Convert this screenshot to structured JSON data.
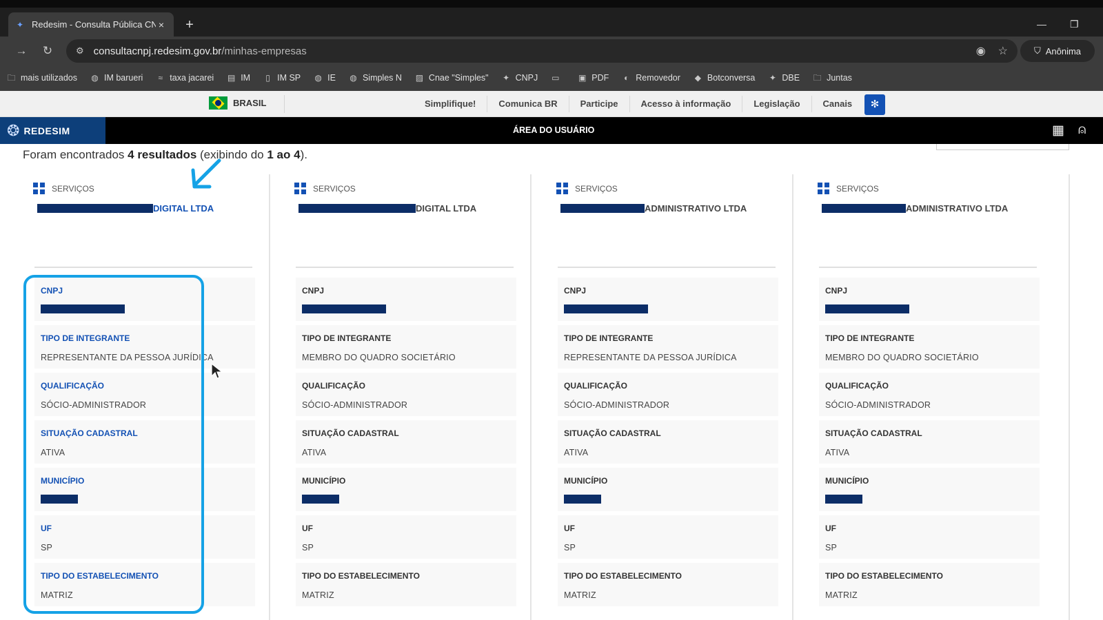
{
  "browser": {
    "tab_title": "Redesim - Consulta Pública CNI",
    "tab_close": "×",
    "new_tab": "+",
    "url_host": "consultacnpj.redesim.gov.br",
    "url_path": "/minhas-empresas",
    "incognito_label": "Anônima",
    "bookmarks": [
      {
        "label": "mais utilizados",
        "icon": "folder-icon"
      },
      {
        "label": "IM barueri",
        "icon": "globe-icon"
      },
      {
        "label": "taxa jacarei",
        "icon": "wave-icon"
      },
      {
        "label": "IM",
        "icon": "eiss-icon"
      },
      {
        "label": "IM SP",
        "icon": "doc-icon"
      },
      {
        "label": "IE",
        "icon": "globe-icon"
      },
      {
        "label": "Simples N",
        "icon": "globe-icon"
      },
      {
        "label": "Cnae \"Simples\"",
        "icon": "stripes-icon"
      },
      {
        "label": "CNPJ",
        "icon": "redesim-icon"
      },
      {
        "label": "",
        "icon": "card-icon"
      },
      {
        "label": "PDF",
        "icon": "pdf-icon"
      },
      {
        "label": "Removedor",
        "icon": "remover-icon"
      },
      {
        "label": "Botconversa",
        "icon": "bot-icon"
      },
      {
        "label": "DBE",
        "icon": "redesim-icon"
      },
      {
        "label": "Juntas",
        "icon": "folder-icon"
      }
    ]
  },
  "gov": {
    "brasil_label": "BRASIL",
    "links": [
      "Simplifique!",
      "Comunica BR",
      "Participe",
      "Acesso à informação",
      "Legislação",
      "Canais"
    ]
  },
  "header": {
    "logo_text": "REDESIM",
    "area_title": "ÁREA DO USUÁRIO"
  },
  "results": {
    "prefix": "Foram encontrados ",
    "count": "4 resultados",
    "middle": " (exibindo do ",
    "range": "1 ao 4",
    "suffix": ")."
  },
  "cards": [
    {
      "service_label": "SERVIÇOS",
      "company_suffix": "DIGITAL LTDA",
      "fields": [
        {
          "label": "CNPJ",
          "value": ""
        },
        {
          "label": "TIPO DE INTEGRANTE",
          "value": "REPRESENTANTE DA PESSOA JURÍDICA"
        },
        {
          "label": "QUALIFICAÇÃO",
          "value": "SÓCIO-ADMINISTRADOR"
        },
        {
          "label": "SITUAÇÃO CADASTRAL",
          "value": "ATIVA"
        },
        {
          "label": "MUNICÍPIO",
          "value": ""
        },
        {
          "label": "UF",
          "value": "SP"
        },
        {
          "label": "TIPO DO ESTABELECIMENTO",
          "value": "MATRIZ"
        }
      ]
    },
    {
      "service_label": "SERVIÇOS",
      "company_suffix": "DIGITAL LTDA",
      "fields": [
        {
          "label": "CNPJ",
          "value": ""
        },
        {
          "label": "TIPO DE INTEGRANTE",
          "value": "MEMBRO DO QUADRO SOCIETÁRIO"
        },
        {
          "label": "QUALIFICAÇÃO",
          "value": "SÓCIO-ADMINISTRADOR"
        },
        {
          "label": "SITUAÇÃO CADASTRAL",
          "value": "ATIVA"
        },
        {
          "label": "MUNICÍPIO",
          "value": ""
        },
        {
          "label": "UF",
          "value": "SP"
        },
        {
          "label": "TIPO DO ESTABELECIMENTO",
          "value": "MATRIZ"
        }
      ]
    },
    {
      "service_label": "SERVIÇOS",
      "company_suffix": "ADMINISTRATIVO LTDA",
      "fields": [
        {
          "label": "CNPJ",
          "value": ""
        },
        {
          "label": "TIPO DE INTEGRANTE",
          "value": "REPRESENTANTE DA PESSOA JURÍDICA"
        },
        {
          "label": "QUALIFICAÇÃO",
          "value": "SÓCIO-ADMINISTRADOR"
        },
        {
          "label": "SITUAÇÃO CADASTRAL",
          "value": "ATIVA"
        },
        {
          "label": "MUNICÍPIO",
          "value": ""
        },
        {
          "label": "UF",
          "value": "SP"
        },
        {
          "label": "TIPO DO ESTABELECIMENTO",
          "value": "MATRIZ"
        }
      ]
    },
    {
      "service_label": "SERVIÇOS",
      "company_suffix": "ADMINISTRATIVO LTDA",
      "fields": [
        {
          "label": "CNPJ",
          "value": ""
        },
        {
          "label": "TIPO DE INTEGRANTE",
          "value": "MEMBRO DO QUADRO SOCIETÁRIO"
        },
        {
          "label": "QUALIFICAÇÃO",
          "value": "SÓCIO-ADMINISTRADOR"
        },
        {
          "label": "SITUAÇÃO CADASTRAL",
          "value": "ATIVA"
        },
        {
          "label": "MUNICÍPIO",
          "value": ""
        },
        {
          "label": "UF",
          "value": "SP"
        },
        {
          "label": "TIPO DO ESTABELECIMENTO",
          "value": "MATRIZ"
        }
      ]
    }
  ],
  "colors": {
    "accent_blue": "#1351b4",
    "redaction": "#0c2d67",
    "annotation": "#15a2e6"
  }
}
